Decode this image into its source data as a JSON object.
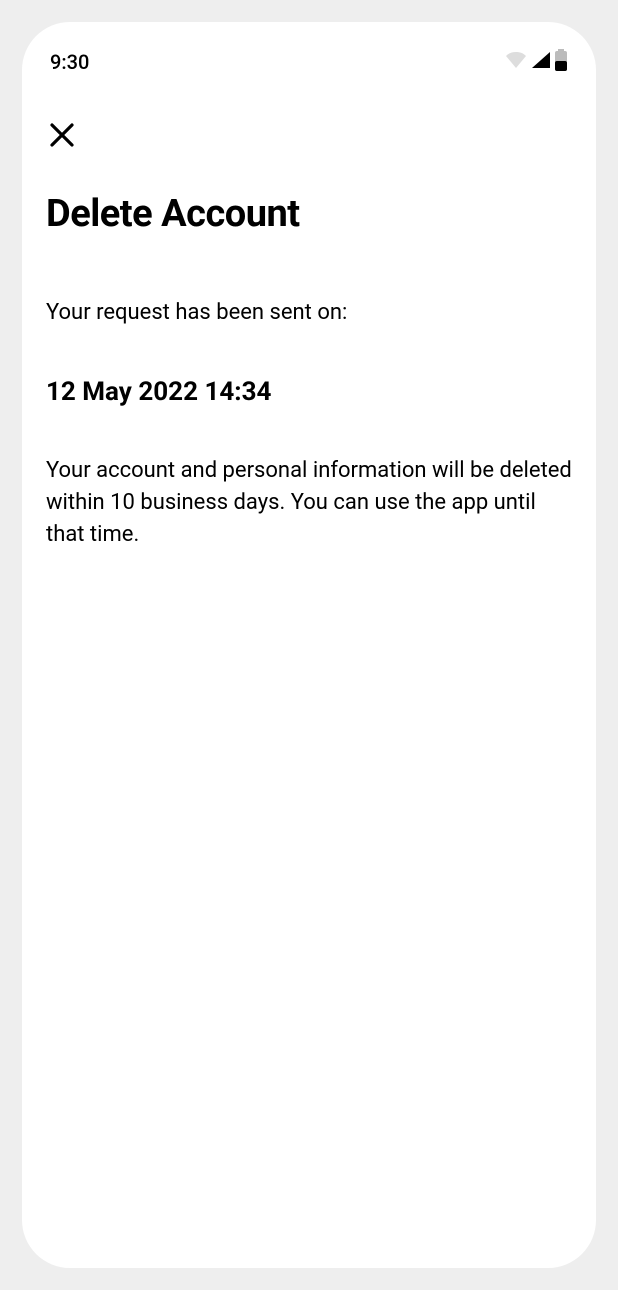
{
  "status": {
    "time": "9:30"
  },
  "page": {
    "title": "Delete Account",
    "intro": "Your request has been sent on:",
    "datetime": "12 May 2022 14:34",
    "body": "Your account and personal information will be deleted within 10 business days. You can use the app until that time."
  }
}
